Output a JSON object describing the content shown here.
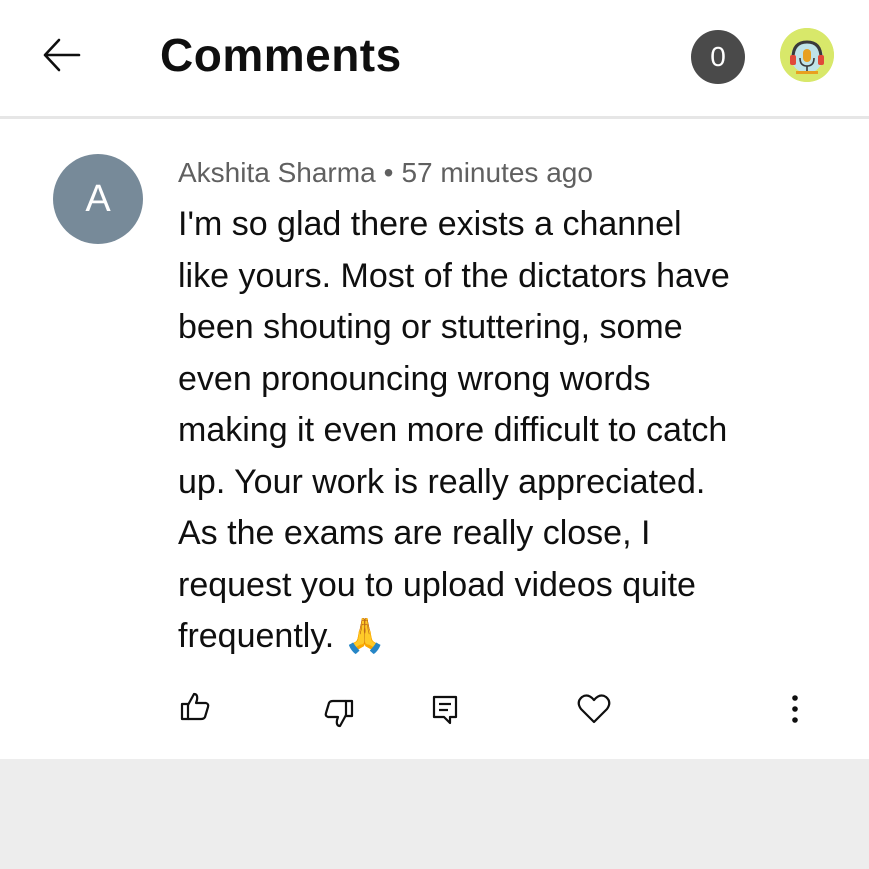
{
  "header": {
    "title": "Comments",
    "notification_count": "0",
    "back_icon": "arrow-left-icon",
    "avatar_icon": "headphones-microphone-icon"
  },
  "comment": {
    "avatar_letter": "A",
    "author": "Akshita Sharma",
    "separator": "•",
    "time": "57 minutes ago",
    "text": "I'm so glad there exists a channel\nlike yours. Most of the dictators have\nbeen shouting or stuttering, some\neven pronouncing wrong words\nmaking it even more difficult to catch\nup. Your work is really appreciated.\nAs the exams are really close, I\nrequest you to upload videos quite\nfrequently. ",
    "emoji": "🙏",
    "actions": [
      "thumbs-up-icon",
      "thumbs-down-icon",
      "reply-icon",
      "heart-icon",
      "more-vertical-icon"
    ]
  },
  "colors": {
    "user_avatar": "#778a99",
    "badge": "#4a4a4a",
    "channel_avatar": "#d8e86a",
    "footer": "#ededed"
  }
}
